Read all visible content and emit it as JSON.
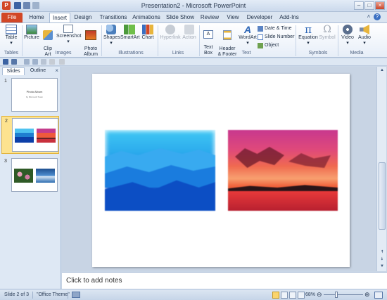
{
  "window": {
    "title": "Presentation2  -  Microsoft PowerPoint",
    "app_icon": "P"
  },
  "tabs": [
    "File",
    "Home",
    "Insert",
    "Design",
    "Transitions",
    "Animations",
    "Slide Show",
    "Review",
    "View",
    "Developer",
    "Add-Ins"
  ],
  "ribbon": {
    "table": "Table",
    "picture": "Picture",
    "clip_art": "Clip\nArt",
    "screenshot": "Screenshot",
    "photo_album": "Photo\nAlbum",
    "shapes": "Shapes",
    "smartart": "SmartArt",
    "chart": "Chart",
    "hyperlink": "Hyperlink",
    "action": "Action",
    "text_box": "Text\nBox",
    "header_footer": "Header\n& Footer",
    "wordart": "WordArt",
    "date_time": "Date & Time",
    "slide_number": "Slide Number",
    "object": "Object",
    "equation": "Equation",
    "symbol": "Symbol",
    "video": "Video",
    "audio": "Audio",
    "groups": {
      "tables": "Tables",
      "images": "Images",
      "illustrations": "Illustrations",
      "links": "Links",
      "text": "Text",
      "symbols": "Symbols",
      "media": "Media"
    }
  },
  "pane": {
    "tabs": [
      "Slides",
      "Outline"
    ],
    "close": "×",
    "slides": [
      {
        "num": "1"
      },
      {
        "num": "2"
      },
      {
        "num": "3"
      }
    ],
    "slide1_title": "Photo Album",
    "slide1_sub": "by Microsoft Team"
  },
  "notes_placeholder": "Click to add notes",
  "status": {
    "slide": "Slide 2 of 3",
    "theme": "\"Office Theme\"",
    "zoom": "68%"
  },
  "colors": {
    "file_tab": "#d24726",
    "selected_thumb": "#fde38f",
    "ribbon_bg": "#e7eef8"
  }
}
